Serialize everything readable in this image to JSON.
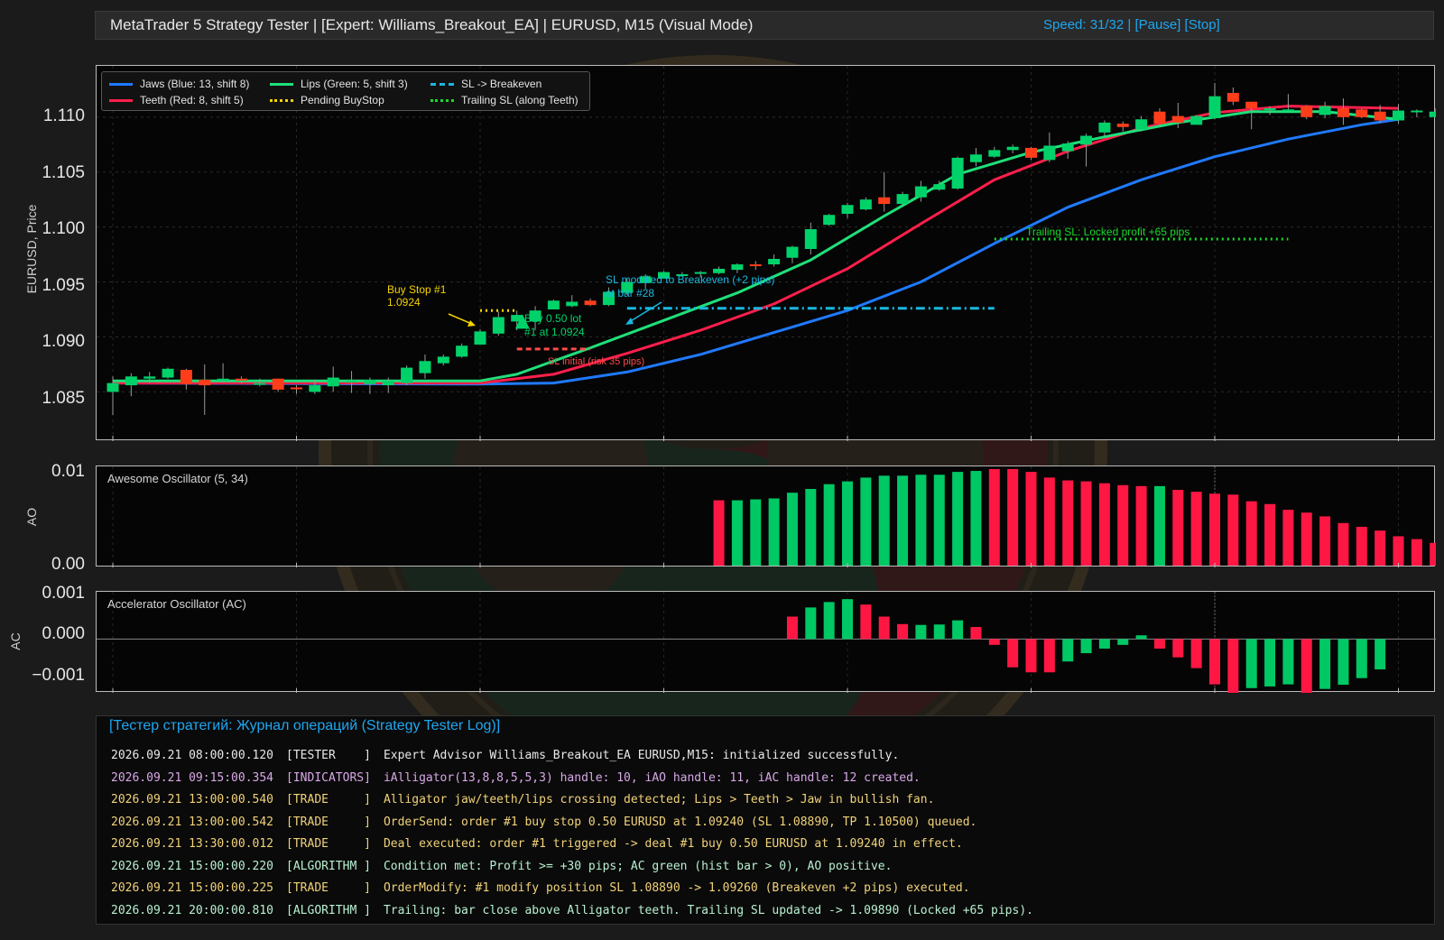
{
  "window": {
    "title": "MetaTrader 5 Strategy Tester  |  [Expert: Williams_Breakout_EA]  |  EURUSD, M15 (Visual Mode)",
    "speed": "Speed: 31/32",
    "separator": " | ",
    "pause": "[Pause]",
    "stop": "[Stop]"
  },
  "main_chart": {
    "ylabel": "EURUSD, Price",
    "yticks": [
      "1.110",
      "1.105",
      "1.100",
      "1.095",
      "1.090",
      "1.085"
    ],
    "legend": {
      "jaws": "Jaws (Blue: 13, shift 8)",
      "teeth": "Teeth (Red: 8, shift 5)",
      "lips": "Lips (Green: 5, shift 3)",
      "pending": "Pending BuyStop",
      "sl_be": "SL -> Breakeven",
      "trailing": "Trailing SL (along Teeth)"
    },
    "annotations": {
      "buystop_line1": "Buy Stop #1",
      "buystop_line2": "1.0924",
      "buy_line1": "Buy 0.50 lot",
      "buy_line2": "#1 at 1.0924",
      "sl_initial": "SL initial (risk 35 pips)",
      "sl_be_line1": "SL modified to Breakeven (+2 pips)",
      "sl_be_line2": "at bar #28",
      "trailing": "Trailing SL: Locked profit +65 pips"
    }
  },
  "ao_panel": {
    "ylabel": "AO",
    "title": "Awesome Oscillator (5, 34)",
    "yticks": [
      "0.01",
      "0.00"
    ]
  },
  "ac_panel": {
    "ylabel": "AC",
    "title": "Accelerator Oscillator (AC)",
    "yticks": [
      "0.001",
      "0.000",
      "−0.001"
    ]
  },
  "colors": {
    "bull": "#00d26a",
    "bear": "#ff3d1a",
    "jaws": "#1f7aff",
    "teeth": "#ff1f4b",
    "lips": "#1fe07a",
    "pending": "#f5d300",
    "sl_be": "#19b8e0",
    "trailing": "#18d82a",
    "ao_up": "#00c864",
    "ao_down": "#ff1744"
  },
  "chart_data": [
    {
      "type": "candlestick",
      "ylim": [
        1.0815,
        1.1145
      ],
      "candles": [
        [
          1.085,
          1.0858,
          1.0829,
          1.0864
        ],
        [
          1.0856,
          1.0864,
          1.0846,
          1.0867
        ],
        [
          1.0862,
          1.0864,
          1.0858,
          1.0868
        ],
        [
          1.0863,
          1.0871,
          1.0862,
          1.0872
        ],
        [
          1.087,
          1.0857,
          1.0852,
          1.0871
        ],
        [
          1.0861,
          1.0856,
          1.0829,
          1.0875
        ],
        [
          1.0862,
          1.0862,
          1.0859,
          1.0876
        ],
        [
          1.0862,
          1.0861,
          1.0858,
          1.0864
        ],
        [
          1.0858,
          1.0858,
          1.0855,
          1.0862
        ],
        [
          1.0862,
          1.0852,
          1.085,
          1.0862
        ],
        [
          1.0854,
          1.0853,
          1.0848,
          1.0856
        ],
        [
          1.085,
          1.0856,
          1.0848,
          1.0861
        ],
        [
          1.0855,
          1.0863,
          1.085,
          1.0873
        ],
        [
          1.086,
          1.086,
          1.0849,
          1.0869
        ],
        [
          1.0857,
          1.0861,
          1.0848,
          1.0863
        ],
        [
          1.0856,
          1.086,
          1.0849,
          1.0863
        ],
        [
          1.0858,
          1.0872,
          1.0856,
          1.0874
        ],
        [
          1.0867,
          1.0878,
          1.0862,
          1.0884
        ],
        [
          1.0876,
          1.0882,
          1.0874,
          1.0884
        ],
        [
          1.0882,
          1.0892,
          1.0881,
          1.0894
        ],
        [
          1.0893,
          1.0905,
          1.0893,
          1.0907
        ],
        [
          1.0903,
          1.0918,
          1.0901,
          1.0923
        ],
        [
          1.0914,
          1.092,
          1.0906,
          1.0924
        ],
        [
          1.0914,
          1.0924,
          1.0906,
          1.0928
        ],
        [
          1.0925,
          1.0933,
          1.0925,
          1.0934
        ],
        [
          1.0928,
          1.0932,
          1.0927,
          1.0938
        ],
        [
          1.0933,
          1.0929,
          1.0928,
          1.0935
        ],
        [
          1.0929,
          1.0941,
          1.0928,
          1.0945
        ],
        [
          1.094,
          1.095,
          1.0938,
          1.0953
        ],
        [
          1.0949,
          1.0955,
          1.0944,
          1.0957
        ],
        [
          1.0953,
          1.0959,
          1.0953,
          1.096
        ],
        [
          1.0957,
          1.0957,
          1.0956,
          1.0959
        ],
        [
          1.0959,
          1.0959,
          1.0954,
          1.096
        ],
        [
          1.0958,
          1.0962,
          1.0957,
          1.0964
        ],
        [
          1.0961,
          1.0966,
          1.0958,
          1.0967
        ],
        [
          1.0966,
          1.0965,
          1.0961,
          1.0969
        ],
        [
          1.0966,
          1.0971,
          1.0964,
          1.0975
        ],
        [
          1.0972,
          1.0982,
          1.0967,
          1.0983
        ],
        [
          1.098,
          1.0998,
          1.0975,
          1.1004
        ],
        [
          1.1002,
          1.1011,
          1.1001,
          1.1012
        ],
        [
          1.1012,
          1.102,
          1.1008,
          1.1022
        ],
        [
          1.1016,
          1.1025,
          1.1015,
          1.1027
        ],
        [
          1.1027,
          1.1021,
          1.1014,
          1.105
        ],
        [
          1.1021,
          1.103,
          1.102,
          1.1032
        ],
        [
          1.1027,
          1.1037,
          1.1023,
          1.1042
        ],
        [
          1.1034,
          1.1039,
          1.1033,
          1.1042
        ],
        [
          1.1035,
          1.1063,
          1.1034,
          1.1064
        ],
        [
          1.1059,
          1.1066,
          1.1055,
          1.1072
        ],
        [
          1.1064,
          1.107,
          1.1063,
          1.1073
        ],
        [
          1.107,
          1.1073,
          1.1067,
          1.1075
        ],
        [
          1.1072,
          1.1063,
          1.1061,
          1.1073
        ],
        [
          1.1061,
          1.1074,
          1.1059,
          1.1086
        ],
        [
          1.1069,
          1.1076,
          1.1062,
          1.1078
        ],
        [
          1.1075,
          1.1083,
          1.1055,
          1.1085
        ],
        [
          1.1086,
          1.1095,
          1.1083,
          1.1097
        ],
        [
          1.1094,
          1.1091,
          1.1087,
          1.1096
        ],
        [
          1.1089,
          1.1098,
          1.1087,
          1.1101
        ],
        [
          1.1105,
          1.1094,
          1.1092,
          1.1108
        ],
        [
          1.1101,
          1.1095,
          1.109,
          1.1113
        ],
        [
          1.1093,
          1.1101,
          1.1093,
          1.1102
        ],
        [
          1.1099,
          1.1119,
          1.1098,
          1.1131
        ],
        [
          1.1122,
          1.1114,
          1.1111,
          1.1127
        ],
        [
          1.1114,
          1.1108,
          1.1089,
          1.1114
        ],
        [
          1.1107,
          1.1108,
          1.1102,
          1.111
        ],
        [
          1.1107,
          1.1107,
          1.1106,
          1.1121
        ],
        [
          1.111,
          1.11,
          1.1098,
          1.1111
        ],
        [
          1.1102,
          1.111,
          1.1099,
          1.1114
        ],
        [
          1.1108,
          1.11,
          1.1093,
          1.1117
        ],
        [
          1.1107,
          1.11,
          1.1099,
          1.1108
        ],
        [
          1.1105,
          1.1097,
          1.1095,
          1.1111
        ],
        [
          1.1097,
          1.1106,
          1.1094,
          1.1112
        ],
        [
          1.1106,
          1.1106,
          1.11,
          1.1107
        ],
        [
          1.11,
          1.1105,
          1.1101,
          1.1108
        ],
        [
          1.1107,
          1.1099,
          1.1097,
          1.1109
        ]
      ],
      "jaws": [
        [
          0,
          1.0858
        ],
        [
          20,
          1.0857
        ],
        [
          24,
          1.0858
        ],
        [
          28,
          1.0868
        ],
        [
          32,
          1.0884
        ],
        [
          36,
          1.0904
        ],
        [
          40,
          1.0924
        ],
        [
          44,
          1.095
        ],
        [
          48,
          1.0985
        ],
        [
          52,
          1.1018
        ],
        [
          56,
          1.1043
        ],
        [
          60,
          1.1064
        ],
        [
          64,
          1.108
        ],
        [
          68,
          1.1093
        ],
        [
          70,
          1.1098
        ]
      ],
      "teeth": [
        [
          0,
          1.0858
        ],
        [
          20,
          1.0858
        ],
        [
          24,
          1.0866
        ],
        [
          28,
          1.0885
        ],
        [
          32,
          1.0906
        ],
        [
          36,
          1.093
        ],
        [
          40,
          1.0962
        ],
        [
          44,
          1.1003
        ],
        [
          48,
          1.1043
        ],
        [
          52,
          1.1069
        ],
        [
          56,
          1.109
        ],
        [
          60,
          1.1104
        ],
        [
          64,
          1.111
        ],
        [
          70,
          1.1108
        ]
      ],
      "lips": [
        [
          0,
          1.086
        ],
        [
          20,
          1.086
        ],
        [
          22,
          1.0866
        ],
        [
          26,
          1.089
        ],
        [
          30,
          1.0915
        ],
        [
          34,
          1.094
        ],
        [
          38,
          1.097
        ],
        [
          42,
          1.101
        ],
        [
          46,
          1.1048
        ],
        [
          50,
          1.1068
        ],
        [
          54,
          1.1082
        ],
        [
          58,
          1.1095
        ],
        [
          62,
          1.1105
        ],
        [
          66,
          1.1105
        ],
        [
          70,
          1.1098
        ]
      ],
      "pending_buystop": {
        "price": 1.0924,
        "from": 20,
        "to": 22
      },
      "sl_initial": {
        "price": 1.0889,
        "from": 22,
        "to": 26
      },
      "sl_breakeven": {
        "price": 1.0926,
        "from": 28,
        "to": 48
      },
      "trailing_sl": {
        "price": 1.0989,
        "from": 48,
        "to": 64
      }
    },
    {
      "type": "bar",
      "title": "Awesome Oscillator (5, 34)",
      "ylim": [
        0,
        0.0101
      ],
      "start_index": 33,
      "values": [
        0.0069,
        0.0069,
        0.007,
        0.0071,
        0.0077,
        0.0081,
        0.0086,
        0.0089,
        0.0093,
        0.0095,
        0.0095,
        0.0096,
        0.0096,
        0.0099,
        0.01,
        0.0102,
        0.0102,
        0.0099,
        0.0093,
        0.009,
        0.0089,
        0.0087,
        0.0085,
        0.0084,
        0.0084,
        0.008,
        0.0078,
        0.0076,
        0.0075,
        0.0068,
        0.0065,
        0.0059,
        0.0056,
        0.0052,
        0.0045,
        0.0041,
        0.0037,
        0.0031,
        0.0028,
        0.0024,
        0.0021,
        0.0018,
        0.0015
      ],
      "colors": [
        "down",
        "up",
        "up",
        "up",
        "up",
        "up",
        "up",
        "up",
        "up",
        "up",
        "up",
        "up",
        "up",
        "up",
        "up",
        "down",
        "down",
        "down",
        "down",
        "down",
        "down",
        "down",
        "down",
        "down",
        "up",
        "down",
        "down",
        "down",
        "down",
        "down",
        "down",
        "down",
        "down",
        "down",
        "down",
        "down",
        "down",
        "down",
        "down",
        "down",
        "down",
        "down",
        "down"
      ]
    },
    {
      "type": "bar",
      "title": "Accelerator Oscillator (AC)",
      "ylim": [
        -0.00125,
        0.00105
      ],
      "start_index": 37,
      "values": [
        0.00054,
        0.00076,
        0.00089,
        0.00096,
        0.00083,
        0.00054,
        0.00036,
        0.00034,
        0.00035,
        0.00045,
        0.00029,
        -0.00014,
        -0.00068,
        -0.0008,
        -0.0008,
        -0.00054,
        -0.00034,
        -0.00023,
        -0.00014,
        9e-05,
        -0.00023,
        -0.00044,
        -0.0007,
        -0.00109,
        -0.00133,
        -0.00118,
        -0.00114,
        -0.00109,
        -0.0013,
        -0.0012,
        -0.0011,
        -0.00094,
        -0.00073
      ],
      "colors": [
        "down",
        "up",
        "up",
        "up",
        "down",
        "down",
        "down",
        "up",
        "up",
        "up",
        "down",
        "down",
        "down",
        "down",
        "down",
        "up",
        "up",
        "up",
        "up",
        "up",
        "down",
        "down",
        "down",
        "down",
        "down",
        "up",
        "up",
        "up",
        "down",
        "up",
        "up",
        "up",
        "up"
      ]
    }
  ],
  "log": {
    "header": "[Тестер стратегий: Журнал операций (Strategy Tester Log)]",
    "rows": [
      {
        "ts": "2026.09.21 08:00:00.120",
        "tag": "[TESTER    ]",
        "kind": "tester",
        "msg": "Expert Advisor Williams_Breakout_EA EURUSD,M15: initialized successfully."
      },
      {
        "ts": "2026.09.21 09:15:00.354",
        "tag": "[INDICATORS]",
        "kind": "indicators",
        "msg": "iAlligator(13,8,8,5,5,3) handle: 10, iAO handle: 11, iAC handle: 12 created."
      },
      {
        "ts": "2026.09.21 13:00:00.540",
        "tag": "[TRADE     ]",
        "kind": "trade",
        "msg": "Alligator jaw/teeth/lips crossing detected; Lips > Teeth > Jaw in bullish fan."
      },
      {
        "ts": "2026.09.21 13:00:00.542",
        "tag": "[TRADE     ]",
        "kind": "trade",
        "msg": "OrderSend: order #1 buy stop 0.50 EURUSD at 1.09240 (SL 1.08890, TP 1.10500) queued."
      },
      {
        "ts": "2026.09.21 13:30:00.012",
        "tag": "[TRADE     ]",
        "kind": "trade",
        "msg": "Deal executed: order #1 triggered -> deal #1 buy 0.50 EURUSD at 1.09240 in effect."
      },
      {
        "ts": "2026.09.21 15:00:00.220",
        "tag": "[ALGORITHM ]",
        "kind": "algorithm",
        "msg": "Condition met: Profit >= +30 pips; AC green (hist bar > 0), AO positive."
      },
      {
        "ts": "2026.09.21 15:00:00.225",
        "tag": "[TRADE     ]",
        "kind": "trade",
        "msg": "OrderModify: #1 modify position SL 1.08890 -> 1.09260 (Breakeven +2 pips) executed."
      },
      {
        "ts": "2026.09.21 20:00:00.810",
        "tag": "[ALGORITHM ]",
        "kind": "algorithm",
        "msg": "Trailing: bar close above Alligator teeth. Trailing SL updated -> 1.09890 (Locked +65 pips)."
      }
    ]
  }
}
